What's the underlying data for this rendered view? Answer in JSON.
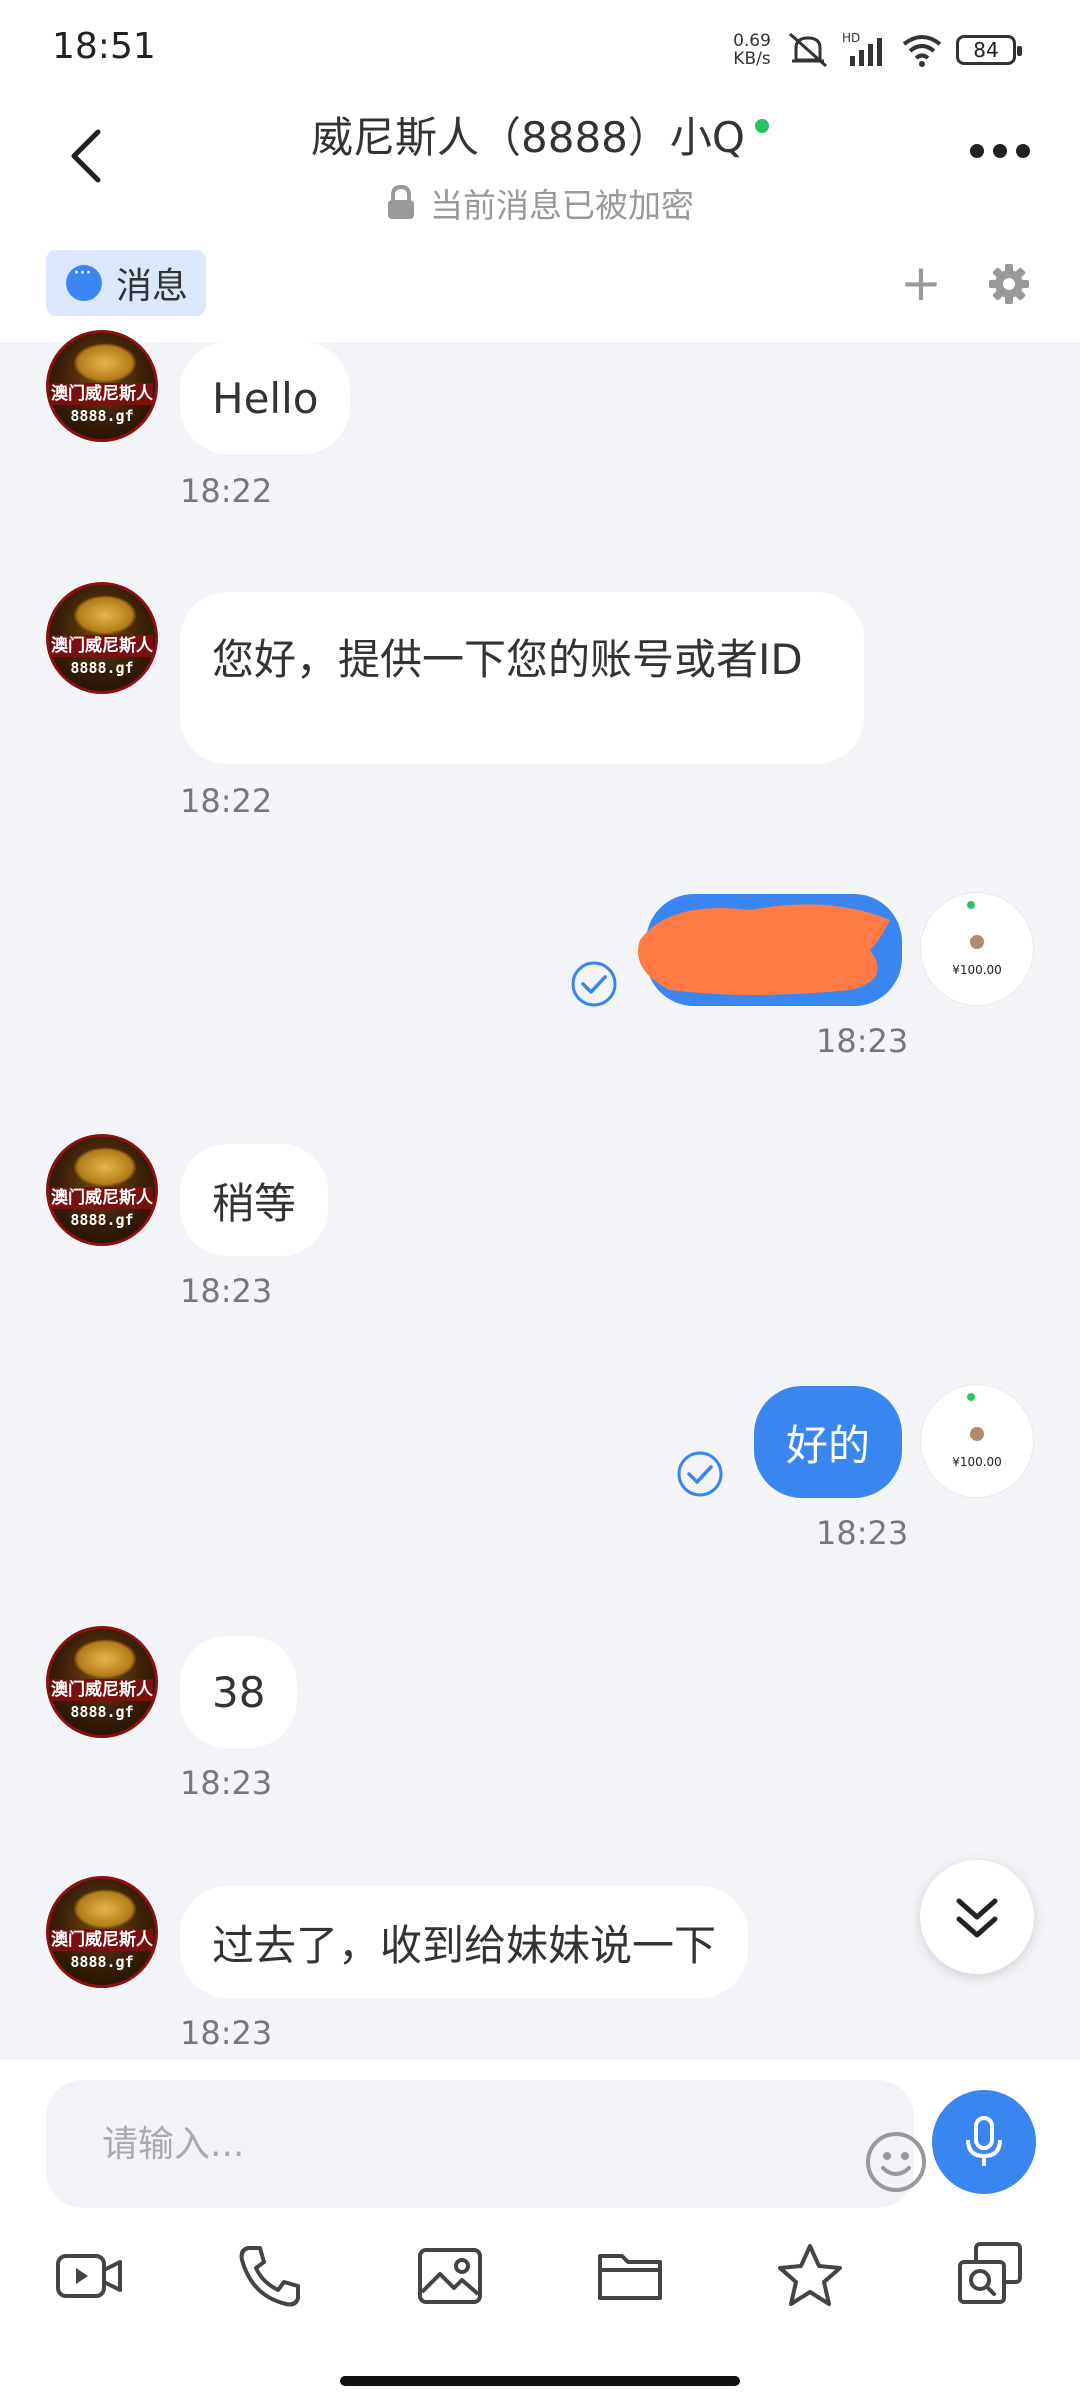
{
  "status_bar": {
    "time": "18:51",
    "net_speed_value": "0.69",
    "net_speed_unit": "KB/s",
    "battery": "84"
  },
  "header": {
    "title": "威尼斯人（8888）小Q",
    "encryption_notice": "当前消息已被加密"
  },
  "tabs": {
    "messages_label": "消息"
  },
  "messages": [
    {
      "dir": "in",
      "text": "Hello",
      "time": "18:22"
    },
    {
      "dir": "in",
      "text": "您好，提供一下您的账号或者ID",
      "time": "18:22"
    },
    {
      "dir": "out",
      "text": "",
      "time": "18:23",
      "redacted": true
    },
    {
      "dir": "in",
      "text": "稍等",
      "time": "18:23"
    },
    {
      "dir": "out",
      "text": "好的",
      "time": "18:23"
    },
    {
      "dir": "in",
      "text": "38",
      "time": "18:23"
    },
    {
      "dir": "in",
      "text": "过去了，收到给妹妹说一下",
      "time": "18:23"
    }
  ],
  "avatar": {
    "line1": "澳门威尼斯人",
    "line2": "8888.gf"
  },
  "self_avatar": {
    "amount": "¥100.00"
  },
  "composer": {
    "placeholder": "请输入..."
  },
  "colors": {
    "accent": "#3a86f0",
    "online": "#22c55e",
    "redaction": "#ff7a45"
  }
}
